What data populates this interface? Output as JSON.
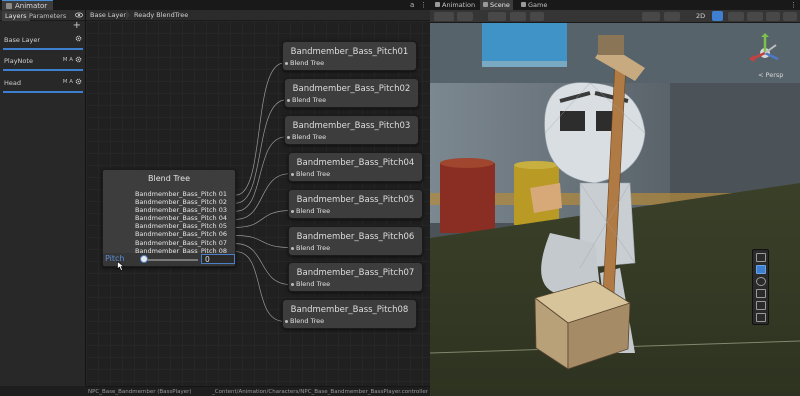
{
  "animator": {
    "window_tab": "Animator",
    "window_controls": [
      "a",
      "⋮"
    ],
    "left_tabs": [
      "Layers",
      "Parameters"
    ],
    "add_label": "+",
    "layers": [
      {
        "name": "Base Layer",
        "ma": ""
      },
      {
        "name": "PlayNote",
        "ma": "M A"
      },
      {
        "name": "Head",
        "ma": "M A"
      }
    ],
    "breadcrumbs": [
      "Base Layer",
      "Ready BlendTree"
    ],
    "blend_tree": {
      "title": "Blend Tree",
      "items": [
        "Bandmember_Bass_Pitch 01",
        "Bandmember_Bass_Pitch 02",
        "Bandmember_Bass_Pitch 03",
        "Bandmember_Bass_Pitch 04",
        "Bandmember_Bass_Pitch 05",
        "Bandmember_Bass_Pitch 06",
        "Bandmember_Bass_Pitch 07",
        "Bandmember_Bass_Pitch 08"
      ],
      "parameter": "Pitch",
      "value": "0",
      "slider_fraction": 0
    },
    "child_nodes": [
      {
        "title": "Bandmember_Bass_Pitch01",
        "subtitle": "Blend Tree"
      },
      {
        "title": "Bandmember_Bass_Pitch02",
        "subtitle": "Blend Tree"
      },
      {
        "title": "Bandmember_Bass_Pitch03",
        "subtitle": "Blend Tree"
      },
      {
        "title": "Bandmember_Bass_Pitch04",
        "subtitle": "Blend Tree"
      },
      {
        "title": "Bandmember_Bass_Pitch05",
        "subtitle": "Blend Tree"
      },
      {
        "title": "Bandmember_Bass_Pitch06",
        "subtitle": "Blend Tree"
      },
      {
        "title": "Bandmember_Bass_Pitch07",
        "subtitle": "Blend Tree"
      },
      {
        "title": "Bandmember_Bass_Pitch08",
        "subtitle": "Blend Tree"
      }
    ],
    "status_left": "NPC_Base_Bandmember (BassPlayer)",
    "status_right": "_Content/Animation/Characters/NPC_Base_Bandmember_BassPlayer.controller"
  },
  "scene": {
    "tabs": [
      "Animation",
      "Scene",
      "Game"
    ],
    "active_tab": "Scene",
    "toolbar_2d": "2D",
    "persp_label": "< Persp"
  },
  "colors": {
    "accent": "#3e7fd0",
    "param_blue": "#5a8fd8"
  }
}
